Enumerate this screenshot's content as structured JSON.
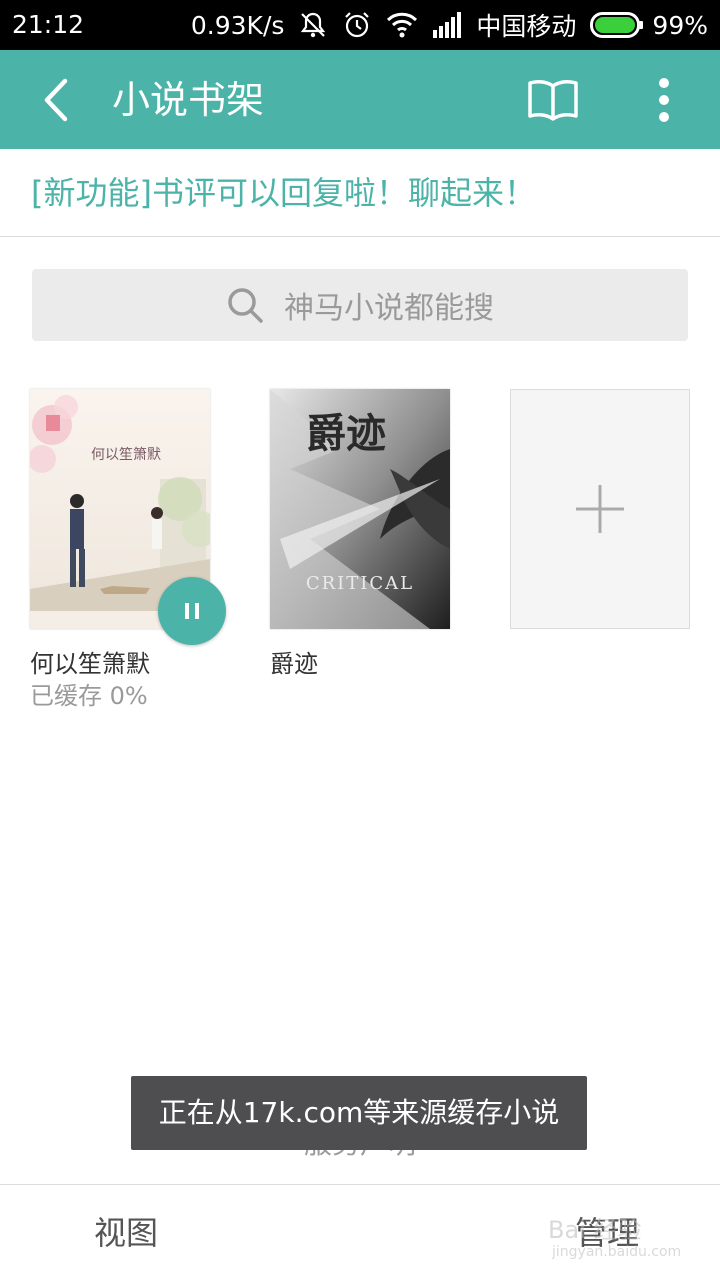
{
  "status_bar": {
    "time": "21:12",
    "network_speed": "0.93K/s",
    "carrier": "中国移动",
    "battery": "99%",
    "battery_color": "#3ccf3c",
    "icons": [
      "mute-icon",
      "alarm-icon",
      "wifi-icon",
      "signal-icon",
      "battery-icon"
    ]
  },
  "app_bar": {
    "title": "小说书架",
    "color": "#4cb3a9",
    "icons": [
      "back-icon",
      "open-book-icon",
      "more-vert-icon"
    ]
  },
  "notice": {
    "text": "[新功能]书评可以回复啦！聊起来！"
  },
  "search": {
    "placeholder": "神马小说都能搜",
    "icon": "search-icon"
  },
  "shelf": {
    "books": [
      {
        "title": "何以笙箫默",
        "status": "已缓存 0%",
        "cover_text": "何以笙箫默",
        "download_progress": 0,
        "action_icon": "pause-icon"
      },
      {
        "title": "爵迹",
        "status": "",
        "cover_text": "爵迹",
        "cover_subtext": "CRITICAL"
      }
    ],
    "add_icon": "plus-icon"
  },
  "footer": {
    "service_link": "服务声明",
    "tabs": {
      "view": "视图",
      "manage": "管理"
    }
  },
  "toast": {
    "text": "正在从17k.com等来源缓存小说"
  },
  "watermark": {
    "text": "Bai 经验",
    "sub": "jingyan.baidu.com"
  }
}
